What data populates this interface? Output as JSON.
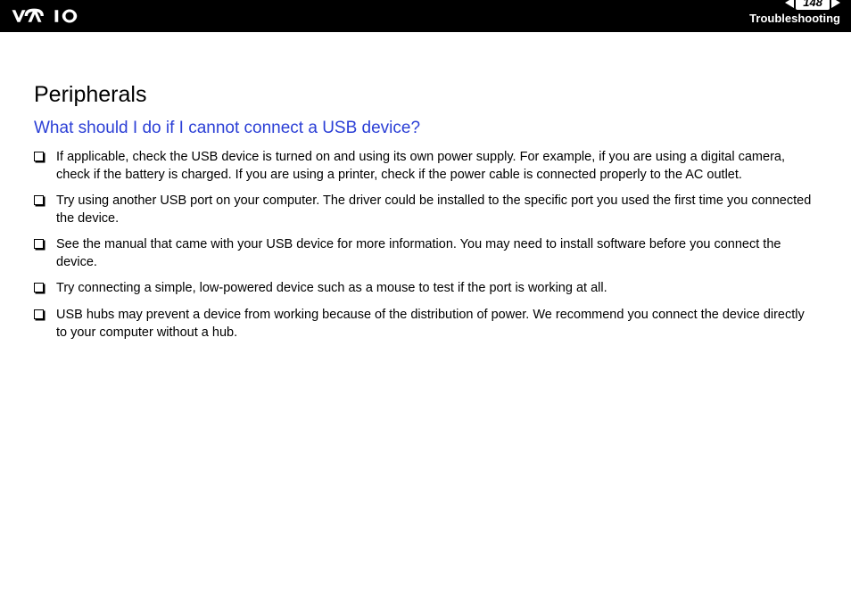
{
  "header": {
    "page_number": "148",
    "section_label": "Troubleshooting"
  },
  "content": {
    "title": "Peripherals",
    "question": "What should I do if I cannot connect a USB device?",
    "bullets": [
      "If applicable, check the USB device is turned on and using its own power supply. For example, if you are using a digital camera, check if the battery is charged. If you are using a printer, check if the power cable is connected properly to the AC outlet.",
      "Try using another USB port on your computer. The driver could be installed to the specific port you used the first time you connected the device.",
      "See the manual that came with your USB device for more information. You may need to install software before you connect the device.",
      "Try connecting a simple, low-powered device such as a mouse to test if the port is working at all.",
      "USB hubs may prevent a device from working because of the distribution of power. We recommend you connect the device directly to your computer without a hub."
    ]
  }
}
